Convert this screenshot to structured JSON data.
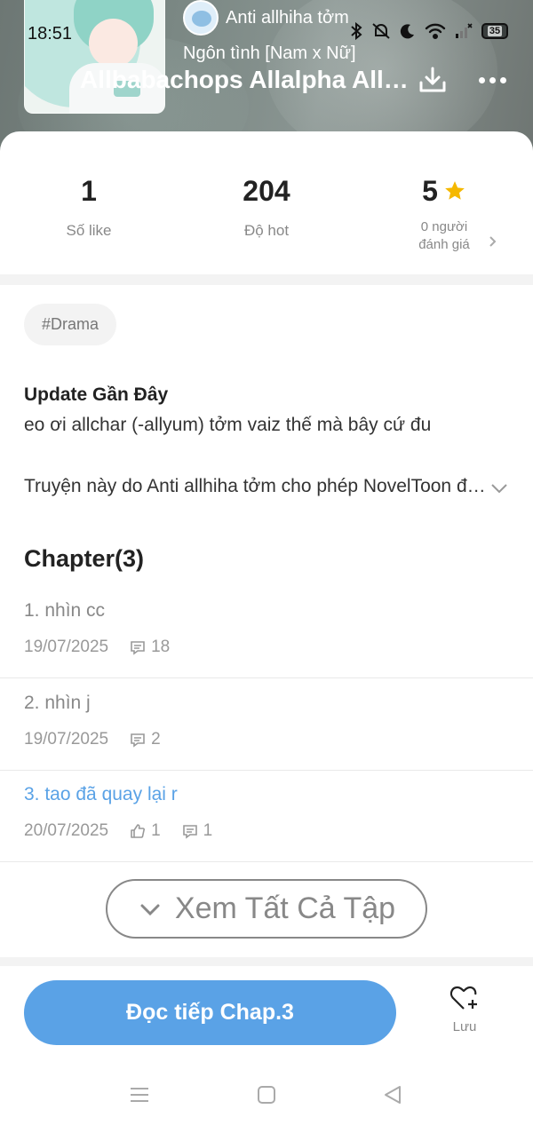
{
  "status_bar": {
    "time": "18:51",
    "battery": "35"
  },
  "header": {
    "author_name": "Anti allhiha tởm",
    "genre": "Ngôn tình [Nam x Nữ]",
    "title": "Allbabachops Allalpha Alltởm"
  },
  "stats": {
    "likes": {
      "value": "1",
      "label": "Số like"
    },
    "hot": {
      "value": "204",
      "label": "Độ hot"
    },
    "rating": {
      "value": "5",
      "label_line1": "0 người",
      "label_line2": "đánh giá"
    }
  },
  "tags": [
    "#Drama"
  ],
  "update": {
    "heading": "Update Gần Đây",
    "text": "eo ơi allchar (-allyum) tởm vaiz thế mà bây cứ đu"
  },
  "summary": "Truyện này do Anti allhiha tởm cho phép NovelToon đăng tải",
  "chapters": {
    "heading": "Chapter(3)",
    "items": [
      {
        "name": "1. nhìn cc",
        "date": "19/07/2025",
        "likes": "",
        "comments": "18"
      },
      {
        "name": "2. nhìn j",
        "date": "19/07/2025",
        "likes": "",
        "comments": "2"
      },
      {
        "name": "3. tao đã quay lại r",
        "date": "20/07/2025",
        "likes": "1",
        "comments": "1"
      }
    ]
  },
  "see_all_label": "Xem Tất Cả Tập",
  "bottom": {
    "read_label": "Đọc tiếp Chap.3",
    "save_label": "Lưu"
  },
  "colors": {
    "accent": "#5aa2e6",
    "star": "#f5b800"
  }
}
